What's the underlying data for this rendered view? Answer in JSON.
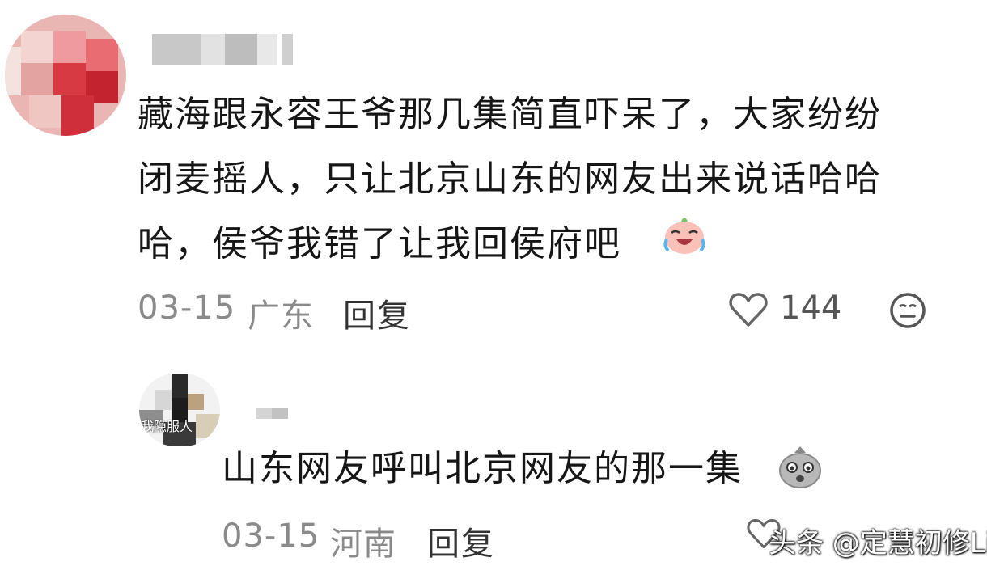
{
  "comments": [
    {
      "text": "藏海跟永容王爷那几集简直吓呆了，大家纷纷闭麦摇人，只让北京山东的网友出来说话哈哈哈，侯爷我错了让我回侯府吧",
      "line1": "藏海跟永容王爷那几集简直吓呆了，大家纷纷",
      "line2": "闭麦摇人，只让北京山东的网友出来说话哈哈",
      "line3": "哈，侯爷我错了让我回侯府吧",
      "emoji": "crying-laughing-emoji",
      "date": "03-15",
      "location": "广东",
      "reply_label": "回复",
      "likes": "144"
    }
  ],
  "replies": [
    {
      "text": "山东网友呼叫北京网友的那一集",
      "emoji": "gloomy-face-emoji",
      "date": "03-15",
      "location": "河南",
      "reply_label": "回复",
      "avatar_caption": "我隐服人"
    }
  ],
  "watermark": "头条 @定慧初修Li",
  "colors": {
    "text": "#161616",
    "meta": "#8a8a8a",
    "background": "#ffffff"
  }
}
